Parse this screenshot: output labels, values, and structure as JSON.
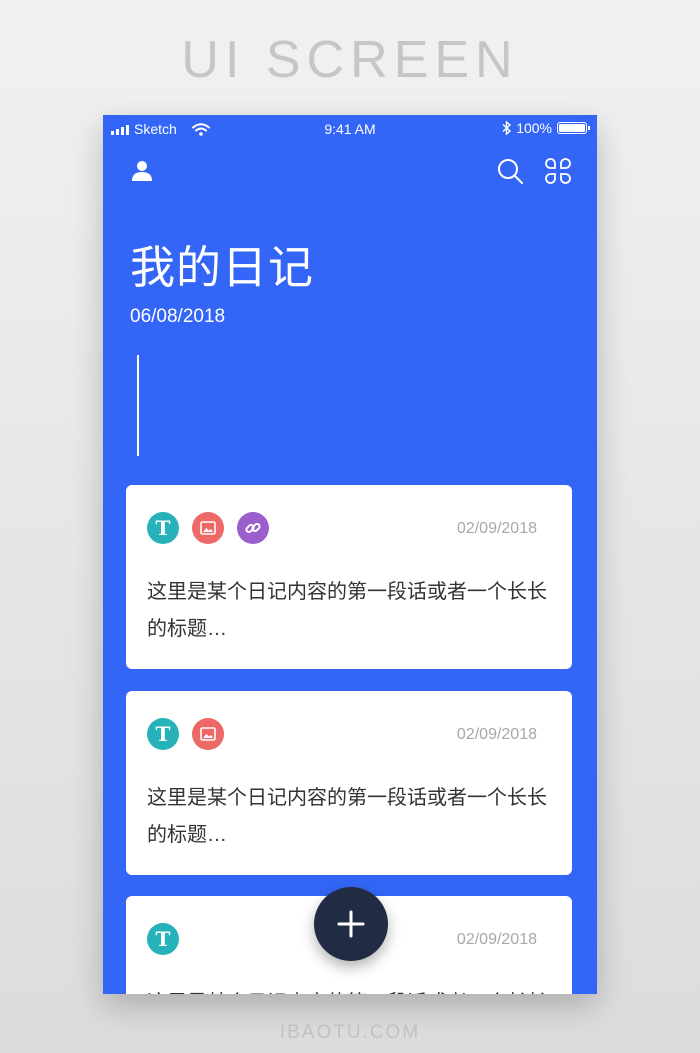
{
  "frame": {
    "title": "UI SCREEN",
    "footer": "IBAOTU.COM"
  },
  "status_bar": {
    "carrier": "Sketch",
    "time": "9:41 AM",
    "battery": "100%",
    "battery_level": 1.0
  },
  "nav": {
    "left_icon": "user-icon",
    "right_icons": [
      "search-icon",
      "grid-menu-icon"
    ]
  },
  "header": {
    "title": "我的日记",
    "date": "06/08/2018"
  },
  "entries": [
    {
      "tags": [
        "text-tag-icon",
        "image-tag-icon",
        "link-tag-icon"
      ],
      "date": "02/09/2018",
      "text": "这里是某个日记内容的第一段话或者一个长长的标题…"
    },
    {
      "tags": [
        "text-tag-icon",
        "image-tag-icon"
      ],
      "date": "02/09/2018",
      "text": "这里是某个日记内容的第一段话或者一个长长的标题…"
    },
    {
      "tags": [
        "text-tag-icon"
      ],
      "date": "02/09/2018",
      "text": "这里是某个日记内容的第一段话或者一个长长的标题…"
    }
  ],
  "tag_glyph": {
    "text": "T"
  },
  "fab": {
    "icon": "plus-icon"
  },
  "colors": {
    "primary": "#3366f6",
    "card": "#ffffff",
    "fab": "#222b44",
    "tag_text": "#27b2b9",
    "tag_image": "#ee6866",
    "tag_link": "#9b5fcd"
  }
}
